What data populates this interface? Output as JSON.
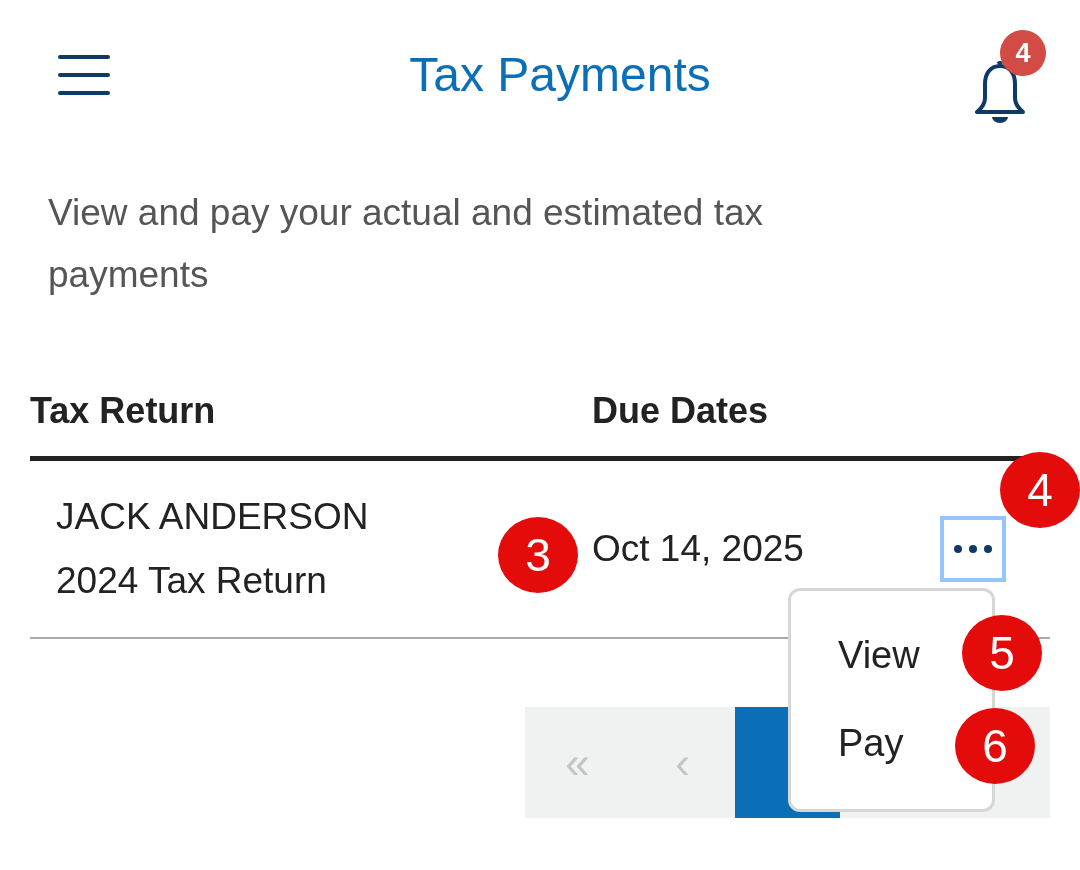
{
  "header": {
    "title": "Tax Payments",
    "notifications": "4"
  },
  "description": "View and pay your actual and estimated tax payments",
  "table": {
    "columns": [
      "Tax Return",
      "Due Dates"
    ],
    "rows": [
      {
        "name": "JACK ANDERSON",
        "return": "2024 Tax Return",
        "due": "Oct 14, 2025"
      }
    ]
  },
  "menu": {
    "expanded": true,
    "items": [
      "View",
      "Pay"
    ]
  },
  "pagination": {
    "items": [
      {
        "label": "«",
        "selected": false,
        "disabled": true
      },
      {
        "label": "‹",
        "selected": false,
        "disabled": true
      },
      {
        "selected": true,
        "disabled": false
      }
    ]
  },
  "callouts": [
    {
      "label": "3"
    },
    {
      "label": "4"
    },
    {
      "label": "5"
    },
    {
      "label": "6"
    }
  ]
}
